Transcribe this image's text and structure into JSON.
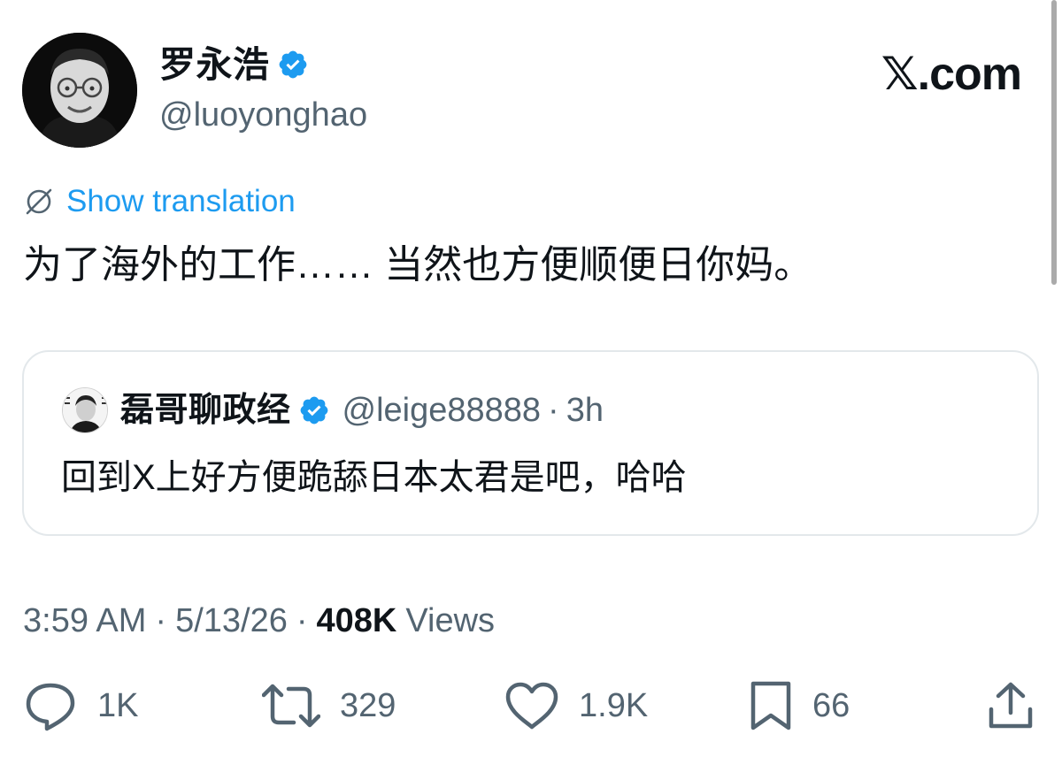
{
  "author": {
    "display_name": "罗永浩",
    "handle": "@luoyonghao",
    "verified": true
  },
  "site_logo": "𝕏.com",
  "translation_link": "Show translation",
  "tweet_text": "为了海外的工作…… 当然也方便顺便日你妈。",
  "quoted_tweet": {
    "display_name": "磊哥聊政经",
    "handle": "@leige88888",
    "separator": "·",
    "time": "3h",
    "text": "回到X上好方便跪舔日本太君是吧，哈哈"
  },
  "meta": {
    "time": "3:59 AM",
    "separator": "·",
    "date": "5/13/26",
    "views_count": "408K",
    "views_label": "Views"
  },
  "actions": {
    "replies": "1K",
    "reposts": "329",
    "likes": "1.9K",
    "bookmarks": "66"
  },
  "colors": {
    "accent": "#1d9bf0",
    "secondary_text": "#536471",
    "primary_text": "#0f1419",
    "border": "#e3e8eb"
  },
  "icons": [
    "verified-badge-icon",
    "translate-globe-icon",
    "reply-icon",
    "repost-icon",
    "like-icon",
    "bookmark-icon",
    "share-icon"
  ]
}
